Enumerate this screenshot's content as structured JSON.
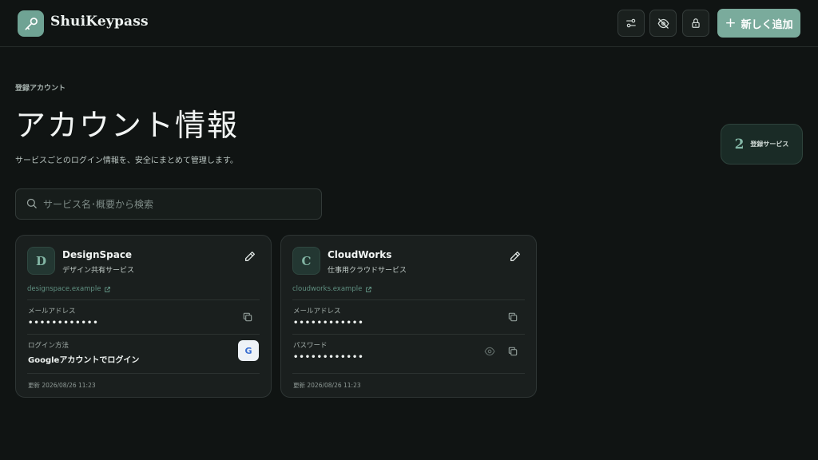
{
  "app": {
    "title": "ShuiKeypass"
  },
  "header": {
    "buttons": {
      "filter": "filter-icon",
      "hide": "eye-off-icon",
      "lock": "lock-icon"
    },
    "add_label": "新しく追加"
  },
  "hero": {
    "eyebrow": "登録アカウント",
    "title": "アカウント情報",
    "subtitle": "サービスごとのログイン情報を、安全にまとめて管理します。",
    "count": "2",
    "count_label": "登録サービス"
  },
  "search": {
    "placeholder": "サービス名･概要から検索"
  },
  "cards": [
    {
      "initial": "D",
      "name": "DesignSpace",
      "description": "デザイン共有サービス",
      "url": "designspace.example",
      "field1_label": "メールアドレス",
      "field1_value": "••••••••••••",
      "field2_label": "ログイン方法",
      "field2_value": "Googleアカウントでログイン",
      "google_badge": "G",
      "updated": "更新 2026/08/26 11:23"
    },
    {
      "initial": "C",
      "name": "CloudWorks",
      "description": "仕事用クラウドサービス",
      "url": "cloudworks.example",
      "field1_label": "メールアドレス",
      "field1_value": "••••••••••••",
      "field2_label": "パスワード",
      "field2_value": "••••••••••••",
      "updated": "更新 2026/08/26 11:23"
    }
  ],
  "colors": {
    "background": "#101413",
    "accent": "#7aab9c",
    "card": "#1a1f1e",
    "link": "#5f8f80"
  }
}
